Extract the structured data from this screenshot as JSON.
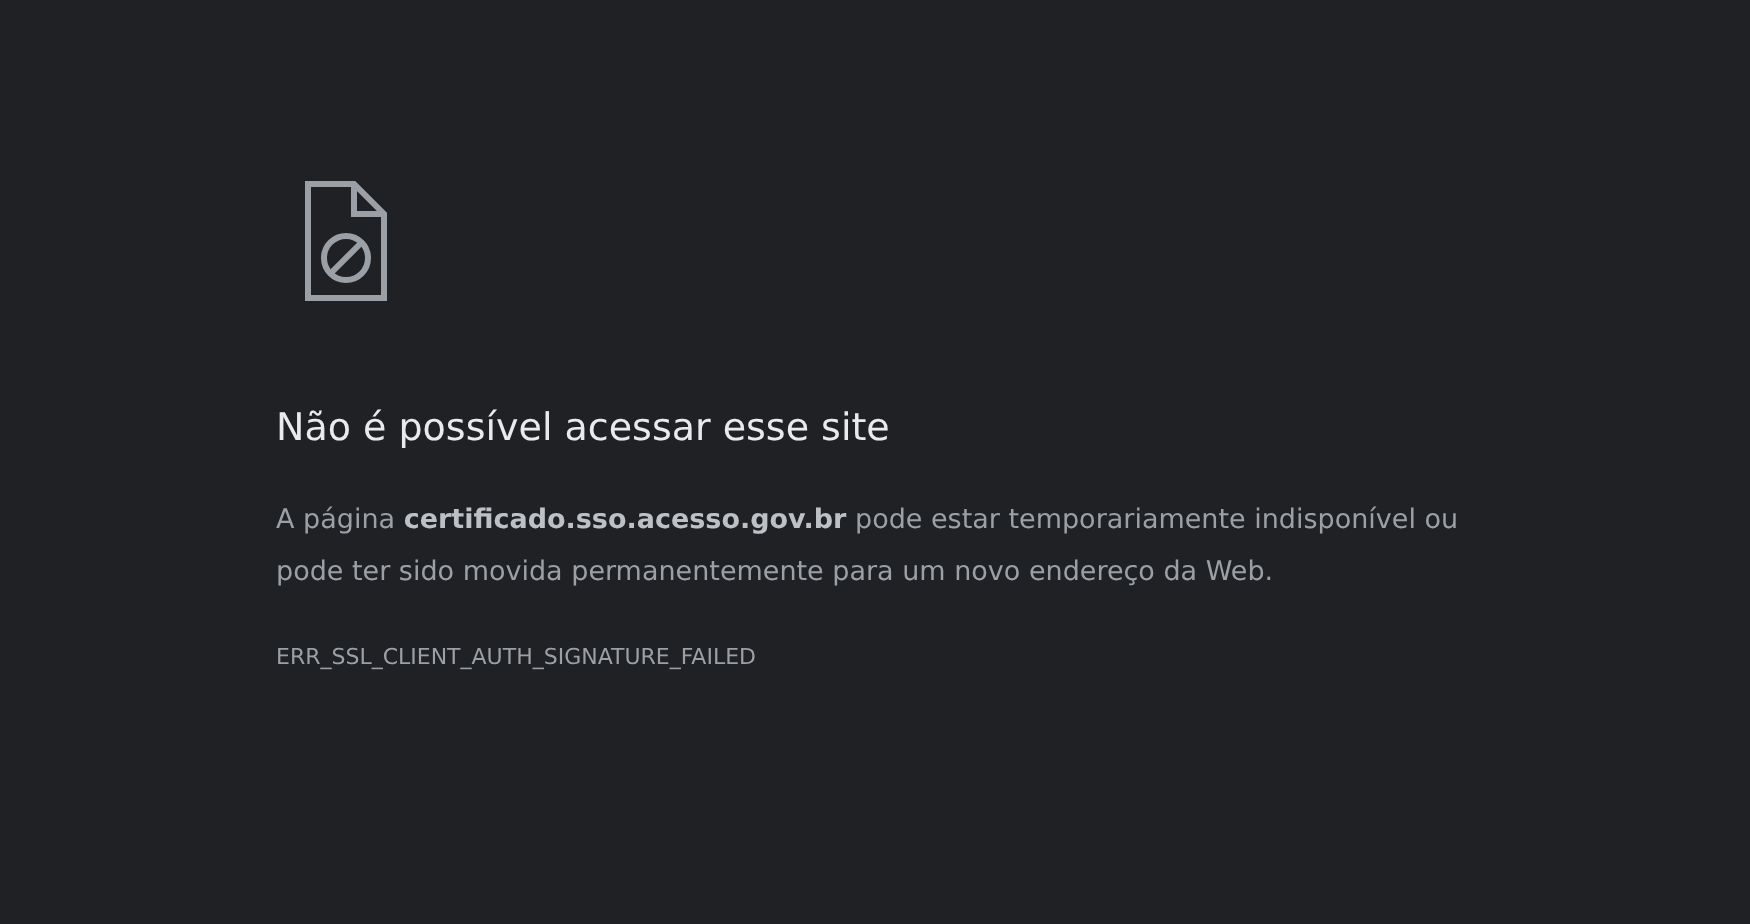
{
  "error_page": {
    "title": "Não é possível acessar esse site",
    "message": "A página **certificado.sso.acesso.gov.br** pode estar temporariamente indisponível ou pode ter sido movida permanentemente para um novo endereço da Web.",
    "error_code": "ERR_SSL_CLIENT_AUTH_SIGNATURE_FAILED"
  }
}
